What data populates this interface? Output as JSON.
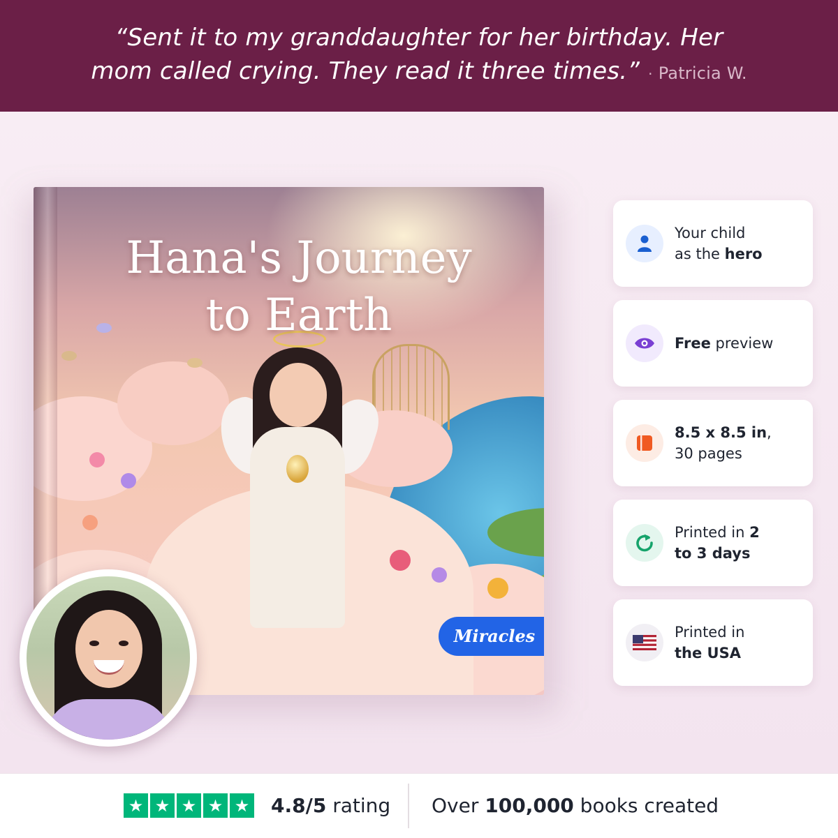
{
  "testimonial": {
    "line1": "“Sent it to my granddaughter for her birthday. Her",
    "line2": "mom called crying. They read it three times.”",
    "separator": "·",
    "author": "Patricia W."
  },
  "book": {
    "title_line1": "Hana's Journey",
    "title_line2": "to Earth",
    "series_badge": "Miracles"
  },
  "features": [
    {
      "icon": "person-icon",
      "text_before": "Your child",
      "text_mid": "as the ",
      "bold": "hero",
      "text_after": "",
      "icon_color": "#1a5fd0",
      "icon_bg": "#e7efff"
    },
    {
      "icon": "eye-icon",
      "bold_first": "Free",
      "text": " preview",
      "icon_color": "#7a3fd3",
      "icon_bg": "#f1eafd"
    },
    {
      "icon": "book-icon",
      "bold": "8.5 x 8.5 in",
      "text_after": ",",
      "line2": "30 pages",
      "icon_color": "#f05a22",
      "icon_bg": "#fdece4"
    },
    {
      "icon": "refresh-icon",
      "text1": "Printed in ",
      "bold1": "2",
      "bold2": "to 3 days",
      "icon_color": "#16a36b",
      "icon_bg": "#e4f6ee"
    },
    {
      "icon": "us-flag-icon",
      "text1": "Printed in",
      "bold": "the USA",
      "icon_color": "#b22234",
      "icon_bg": "#f1eff4"
    }
  ],
  "bottom": {
    "stars": "★",
    "rating_value": "4.8/5",
    "rating_label": " rating",
    "created_prefix": "Over ",
    "created_count": "100,000",
    "created_suffix": " books created"
  },
  "colors": {
    "banner": "#6b1f47",
    "trustpilot_green": "#00b67a",
    "badge_blue": "#2264e6"
  }
}
